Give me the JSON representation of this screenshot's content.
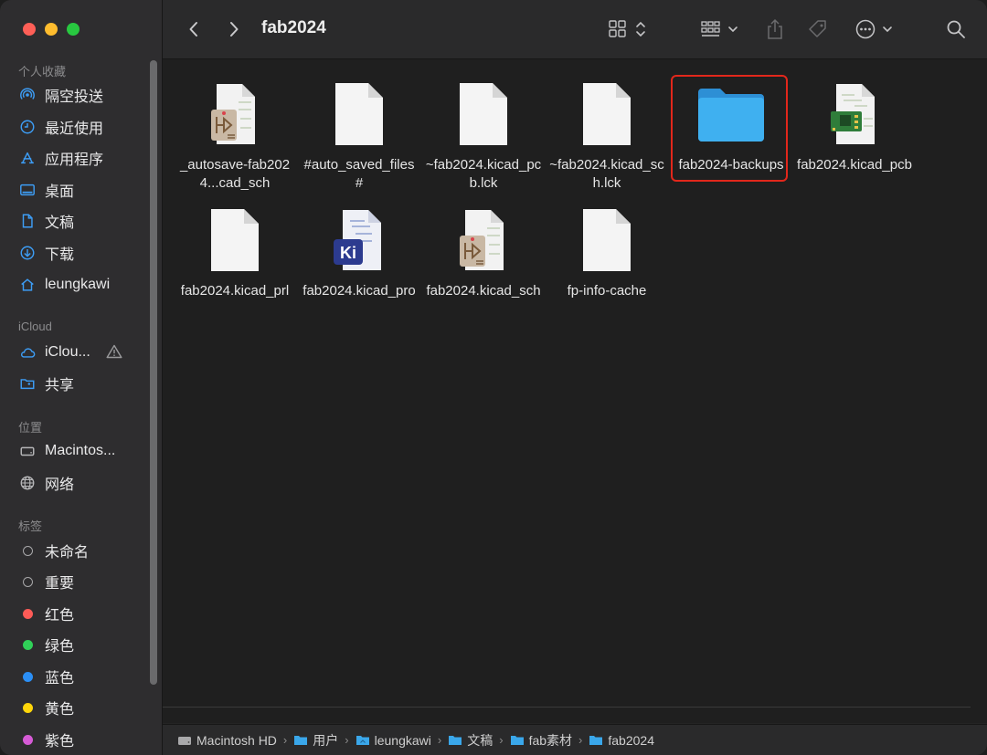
{
  "window": {
    "title": "fab2024"
  },
  "sidebar": {
    "sections": [
      {
        "label": "个人收藏"
      },
      {
        "label": "iCloud"
      },
      {
        "label": "位置"
      },
      {
        "label": "标签"
      }
    ],
    "favorites": [
      {
        "label": "隔空投送",
        "icon": "airdrop-icon"
      },
      {
        "label": "最近使用",
        "icon": "clock-icon"
      },
      {
        "label": "应用程序",
        "icon": "applications-icon"
      },
      {
        "label": "桌面",
        "icon": "desktop-icon"
      },
      {
        "label": "文稿",
        "icon": "document-icon"
      },
      {
        "label": "下载",
        "icon": "download-icon"
      },
      {
        "label": "leungkawi",
        "icon": "home-icon"
      }
    ],
    "icloud": [
      {
        "label": "iClou...",
        "icon": "icloud-icon"
      },
      {
        "label": "共享",
        "icon": "shared-folder-icon"
      }
    ],
    "locations": [
      {
        "label": "Macintos...",
        "icon": "harddisk-icon"
      },
      {
        "label": "网络",
        "icon": "network-icon"
      }
    ],
    "tags": [
      {
        "label": "未命名",
        "color": ""
      },
      {
        "label": "重要",
        "color": ""
      },
      {
        "label": "红色",
        "color": "#fe5b57"
      },
      {
        "label": "绿色",
        "color": "#30d158"
      },
      {
        "label": "蓝色",
        "color": "#2b8ff6"
      },
      {
        "label": "黄色",
        "color": "#ffd60a"
      },
      {
        "label": "紫色",
        "color": "#d65bd6"
      }
    ]
  },
  "files": [
    {
      "name": "_autosave-fab2024...cad_sch",
      "kind": "kicad-sch"
    },
    {
      "name": "#auto_saved_files#",
      "kind": "blank"
    },
    {
      "name": "~fab2024.kicad_pcb.lck",
      "kind": "blank"
    },
    {
      "name": "~fab2024.kicad_sch.lck",
      "kind": "blank"
    },
    {
      "name": "fab2024-backups",
      "kind": "folder",
      "selected": true
    },
    {
      "name": "fab2024.kicad_pcb",
      "kind": "kicad-pcb"
    },
    {
      "name": "fab2024.kicad_prl",
      "kind": "blank"
    },
    {
      "name": "fab2024.kicad_pro",
      "kind": "kicad-pro"
    },
    {
      "name": "fab2024.kicad_sch",
      "kind": "kicad-sch"
    },
    {
      "name": "fp-info-cache",
      "kind": "blank"
    }
  ],
  "pathbar": [
    {
      "label": "Macintosh HD",
      "icon": "harddisk-icon"
    },
    {
      "label": "用户",
      "icon": "folder-icon"
    },
    {
      "label": "leungkawi",
      "icon": "home-folder-icon"
    },
    {
      "label": "文稿",
      "icon": "folder-icon"
    },
    {
      "label": "fab素材",
      "icon": "folder-icon"
    },
    {
      "label": "fab2024",
      "icon": "folder-icon"
    }
  ],
  "colors": {
    "accent_folder": "#3aa7ea",
    "highlight": "#e2271b"
  }
}
